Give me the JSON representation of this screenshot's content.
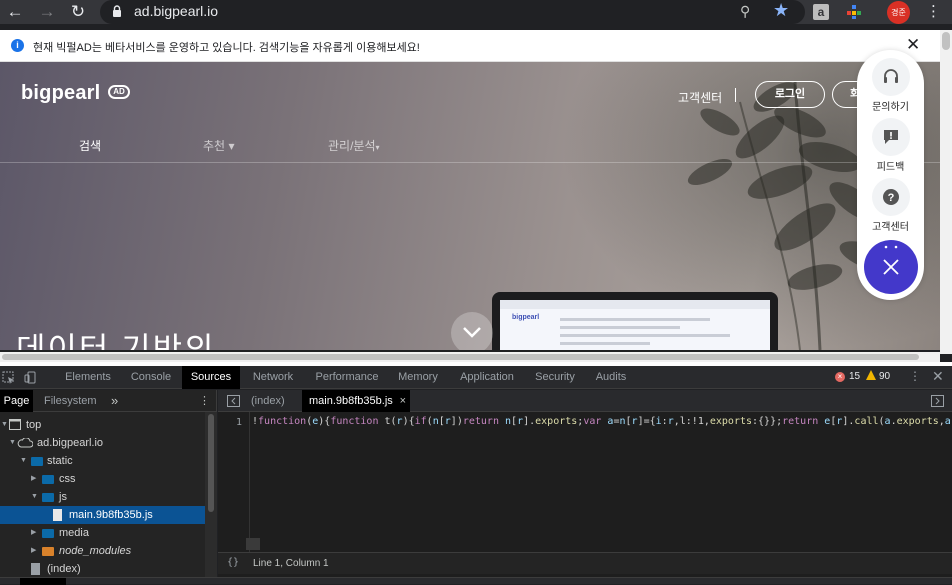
{
  "browser": {
    "url": "ad.bigpearl.io",
    "profile_initials": "경준",
    "extension_a": "a"
  },
  "infobar": {
    "message": "현재 빅펄AD는 베타서비스를 운영하고 있습니다. 검색기능을 자유롭게 이용해보세요!",
    "close": "✕"
  },
  "hero": {
    "logo": "bigpearl",
    "logo_badge": "AD",
    "support_link": "고객센터",
    "login_button": "로그인",
    "signup_button_partial": "회",
    "nav": [
      "검색",
      "추천",
      "관리/분석"
    ],
    "headline": "데이터 기반의",
    "laptop_brand": "bigpearl"
  },
  "widget": {
    "inquiry": "문의하기",
    "feedback": "피드백",
    "support": "고객센터"
  },
  "devtools": {
    "tabs": [
      "Elements",
      "Console",
      "Sources",
      "Network",
      "Performance",
      "Memory",
      "Application",
      "Security",
      "Audits"
    ],
    "active_tab": "Sources",
    "errors": "15",
    "warnings": "90",
    "navigator_tabs": [
      "Page",
      "Filesystem"
    ],
    "more_tabs": "»",
    "tree": {
      "top": "top",
      "domain": "ad.bigpearl.io",
      "static": "static",
      "css": "css",
      "js": "js",
      "file": "main.9b8fb35b.js",
      "media": "media",
      "node_modules": "node_modules",
      "index": "(index)"
    },
    "editor_tabs": [
      "(index)",
      "main.9b8fb35b.js"
    ],
    "line_number": "1",
    "code": "!function(e){function t(r){if(n[r])return n[r].exports;var a=n[r]={i:r,l:!1,exports:{}};return e[r].call(a.exports,a,a",
    "status_braces": "{}",
    "cursor_position": "Line 1, Column 1"
  },
  "colors": {
    "accent": "#4338ca",
    "chrome_blue": "#8ab4f8",
    "selection": "#0b5394"
  }
}
